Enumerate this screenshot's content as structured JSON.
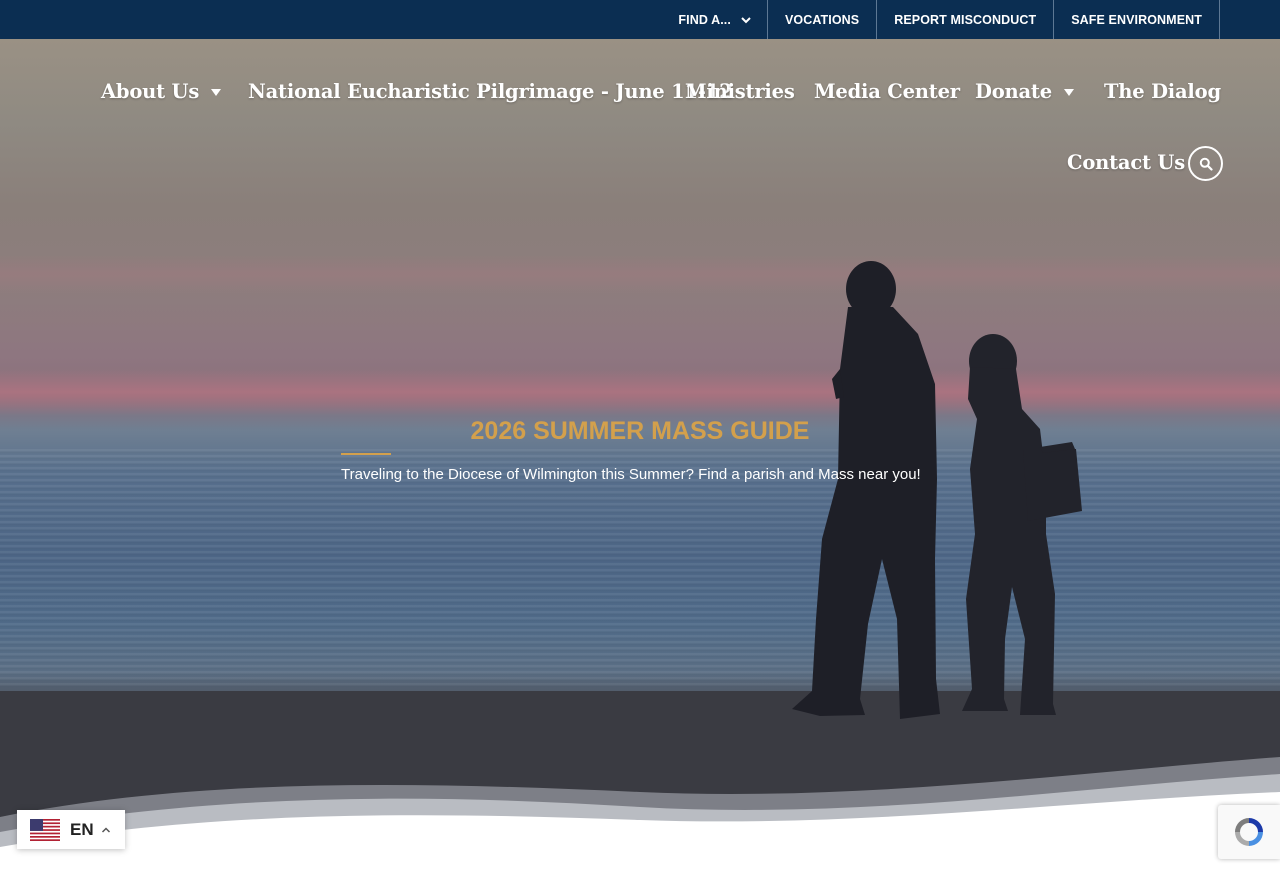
{
  "topbar": {
    "links": [
      {
        "label": "FIND A..."
      },
      {
        "label": "VOCATIONS"
      },
      {
        "label": "REPORT MISCONDUCT"
      },
      {
        "label": "SAFE ENVIRONMENT"
      }
    ]
  },
  "nav": {
    "items": [
      {
        "label": "About Us"
      },
      {
        "label": "National Eucharistic Pilgrimage - June 11-12"
      },
      {
        "label": "Ministries"
      },
      {
        "label": "Media Center"
      },
      {
        "label": "Donate"
      },
      {
        "label": "The Dialog"
      },
      {
        "label": "Contact Us"
      }
    ]
  },
  "hero": {
    "title": "2026 SUMMER MASS GUIDE",
    "subtitle": "Traveling to the Diocese of Wilmington this Summer? Find a parish and Mass near you!"
  },
  "language": {
    "code": "EN",
    "flag": "us-flag-icon"
  },
  "recaptcha": {
    "icon": "recaptcha-icon"
  },
  "colors": {
    "topbar": "#0b2e52",
    "accent": "#d3a04c",
    "text_on_hero": "#ffffff"
  }
}
